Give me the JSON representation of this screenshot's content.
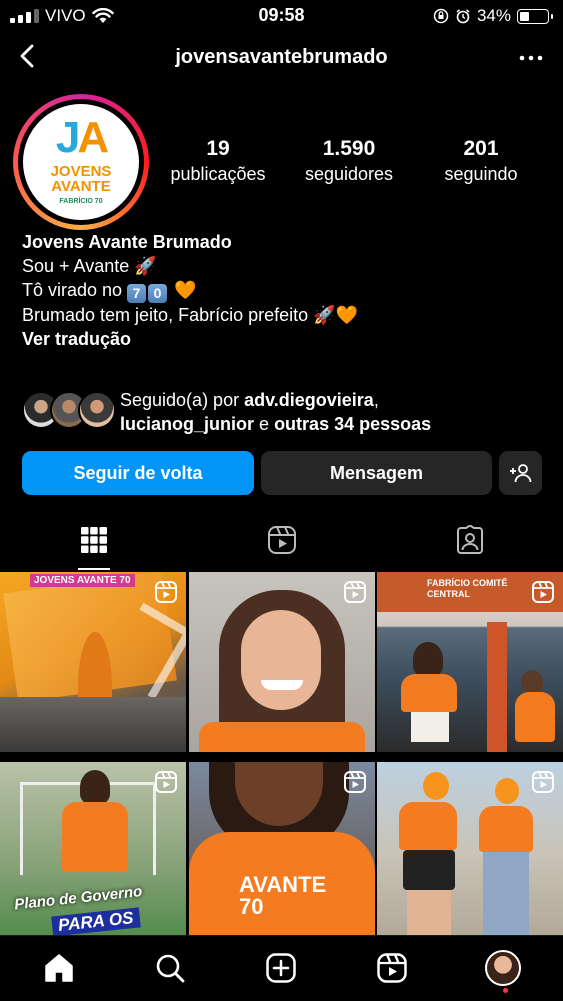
{
  "status": {
    "carrier": "VIVO",
    "time": "09:58",
    "battery": "34%",
    "battery_level": 0.34
  },
  "header": {
    "username": "jovensavantebrumado"
  },
  "avatar_logo": {
    "ja_j": "J",
    "ja_a": "A",
    "line1": "JOVENS",
    "line2": "AVANTE",
    "line3": "FABRÍCIO 70"
  },
  "stats": [
    {
      "value": "19",
      "label": "publicações"
    },
    {
      "value": "1.590",
      "label": "seguidores"
    },
    {
      "value": "201",
      "label": "seguindo"
    }
  ],
  "bio": {
    "name": "Jovens Avante Brumado",
    "line1": "Sou + Avante 🚀",
    "line2_prefix": "Tô virado no",
    "line2_digits": [
      "7",
      "0"
    ],
    "line2_suffix": "🧡",
    "line3": "Brumado tem jeito, Fabrício prefeito 🚀🧡",
    "translate": "Ver tradução"
  },
  "followed_by": {
    "prefix": "Seguido(a) por",
    "user1": "adv.diegovieira",
    "comma": ",",
    "user2": "lucianog_junior",
    "conj": "e",
    "others": "outras 34 pessoas"
  },
  "buttons": {
    "follow_back": "Seguir de volta",
    "message": "Mensagem"
  },
  "tabs": {
    "icons": [
      "grid-icon",
      "reels-icon",
      "tagged-icon"
    ],
    "active": 0
  },
  "posts": {
    "post1_text": "JOVENS AVANTE 70",
    "post2_text": "",
    "post3_text": "FABRÍCIO COMITÊ CENTRAL",
    "post4_text1": "Plano de Governo",
    "post4_text2": "PARA OS",
    "post5_text": "AVANTE 70",
    "post6_text": ""
  },
  "bottom_nav": [
    "home-icon",
    "search-icon",
    "create-icon",
    "reels-icon",
    "profile-avatar"
  ],
  "colors": {
    "follow_button": "#0095f6",
    "secondary_button": "#262626",
    "brand_orange": "#f39200",
    "brand_blue": "#29a8e0"
  }
}
